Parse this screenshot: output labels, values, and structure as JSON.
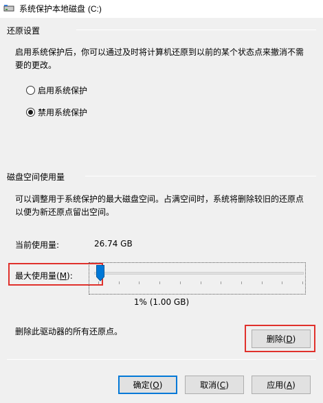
{
  "window": {
    "title": "系统保护本地磁盘",
    "title_drive": "(C:)",
    "icon": "drive-icon"
  },
  "restore_settings": {
    "group_title": "还原设置",
    "description_line1": "启用系统保护后，你可以通过及时将计算机还原到以前的某个状态点来撤消不需",
    "description_line2": "要的更改。",
    "options": [
      {
        "label": "启用系统保护",
        "checked": false
      },
      {
        "label": "禁用系统保护",
        "checked": true
      }
    ]
  },
  "disk_usage": {
    "group_title": "磁盘空间使用量",
    "description_line1": "可以调整用于系统保护的最大磁盘空间。占满空间时，系统将删除较旧的还原点",
    "description_line2": "以便为新还原点留出空间。",
    "current_label": "当前使用量:",
    "current_value": "26.74 GB",
    "max_label_prefix": "最大使用量(",
    "max_label_key": "M",
    "max_label_suffix": "):",
    "slider_percent": 1,
    "slider_value_text": "1% (1.00 GB)"
  },
  "delete_section": {
    "text": "删除此驱动器的所有还原点。",
    "button_prefix": "删除(",
    "button_key": "D",
    "button_suffix": ")"
  },
  "footer": {
    "ok_prefix": "确定(",
    "ok_key": "O",
    "ok_suffix": ")",
    "cancel_prefix": "取消(",
    "cancel_key": "C",
    "cancel_suffix": ")",
    "apply_prefix": "应用(",
    "apply_key": "A",
    "apply_suffix": ")"
  },
  "colors": {
    "highlight_red": "#e0302b",
    "default_button_border": "#0078d7",
    "slider_thumb": "#0078d7"
  }
}
